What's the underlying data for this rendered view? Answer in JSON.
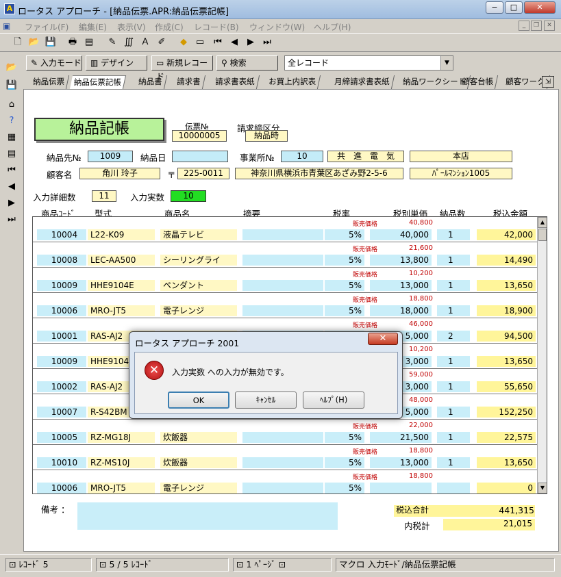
{
  "window": {
    "title": "ロータス アプローチ - [納品伝票.APR:納品伝票記帳]",
    "min": "−",
    "max": "□",
    "close": "✕"
  },
  "menu": [
    "ファイル(F)",
    "編集(E)",
    "表示(V)",
    "作成(C)",
    "レコード(B)",
    "ウィンドウ(W)",
    "ヘルプ(H)"
  ],
  "actionbar": {
    "mode_label": "入力モード",
    "design_label": "デザイン",
    "new_record_label": "新規レコード",
    "find_label": "検索",
    "filter_value": "全レコード"
  },
  "tabs": [
    "納品伝票",
    "納品伝票記帳",
    "納品書",
    "請求書",
    "請求書表紙",
    "お買上内訳表",
    "月締請求書表紙",
    "納品ワークシート",
    "顧客台帳",
    "顧客ワーク"
  ],
  "form": {
    "title": "納品記帳",
    "slip_no_label": "伝票№",
    "slip_no": "10000005",
    "billing_label": "請求締区分",
    "billing": "納品時",
    "dest_no_label": "納品先№",
    "dest_no": "1009",
    "delivery_date_label": "納品日",
    "delivery_date": "",
    "office_no_label": "事業所№",
    "office_no": "10",
    "company": "共　進　電　気",
    "branch": "本店",
    "customer_label": "顧客名",
    "customer": "角川 玲子",
    "zip_mark": "〒",
    "zip": "225-0011",
    "address": "神奈川県横浜市青葉区あざみ野2-5-6",
    "building": "ﾊﾟｰﾙﾏﾝｼｮﾝ1005",
    "detail_count_label": "入力詳細数",
    "detail_count": "11",
    "actual_count_label": "入力実数",
    "actual_count": "10"
  },
  "columns": {
    "code": "商品ｺｰﾄﾞ",
    "model": "型式",
    "name": "商品名",
    "note": "摘要",
    "tax": "税率",
    "unit": "税別単価",
    "qty": "納品数",
    "amount": "税込金額"
  },
  "price_tag": "販売価格",
  "rows": [
    {
      "code": "10004",
      "model": "L22-K09",
      "name": "液晶テレビ",
      "tax": "5%",
      "sale": "40,800",
      "unit": "40,000",
      "qty": "1",
      "amount": "42,000"
    },
    {
      "code": "10008",
      "model": "LEC-AA500",
      "name": "シーリングライ",
      "tax": "5%",
      "sale": "21,600",
      "unit": "13,800",
      "qty": "1",
      "amount": "14,490"
    },
    {
      "code": "10009",
      "model": "HHE9104E",
      "name": "ペンダント",
      "tax": "5%",
      "sale": "10,200",
      "unit": "13,000",
      "qty": "1",
      "amount": "13,650"
    },
    {
      "code": "10006",
      "model": "MRO-JT5",
      "name": "電子レンジ",
      "tax": "5%",
      "sale": "18,800",
      "unit": "18,000",
      "qty": "1",
      "amount": "18,900"
    },
    {
      "code": "10001",
      "model": "RAS-AJ2",
      "name": "",
      "tax": "",
      "sale": "46,000",
      "unit": "5,000",
      "qty": "2",
      "amount": "94,500"
    },
    {
      "code": "10009",
      "model": "HHE9104",
      "name": "",
      "tax": "",
      "sale": "10,200",
      "unit": "3,000",
      "qty": "1",
      "amount": "13,650"
    },
    {
      "code": "10002",
      "model": "RAS-AJ2",
      "name": "",
      "tax": "",
      "sale": "59,000",
      "unit": "3,000",
      "qty": "1",
      "amount": "55,650"
    },
    {
      "code": "10007",
      "model": "R-S42BM",
      "name": "",
      "tax": "",
      "sale": "48,000",
      "unit": "5,000",
      "qty": "1",
      "amount": "152,250"
    },
    {
      "code": "10005",
      "model": "RZ-MG18J",
      "name": "炊飯器",
      "tax": "5%",
      "sale": "22,000",
      "unit": "21,500",
      "qty": "1",
      "amount": "22,575"
    },
    {
      "code": "10010",
      "model": "RZ-MS10J",
      "name": "炊飯器",
      "tax": "5%",
      "sale": "18,800",
      "unit": "13,000",
      "qty": "1",
      "amount": "13,650"
    },
    {
      "code": "10006",
      "model": "MRO-JT5",
      "name": "電子レンジ",
      "tax": "5%",
      "sale": "18,800",
      "unit": "",
      "qty": "",
      "amount": "0"
    }
  ],
  "footer": {
    "memo_label": "備考 ：",
    "total_label": "税込合計",
    "total": "441,315",
    "tax_label": "内税計",
    "tax": "21,015"
  },
  "status": {
    "record": "ﾚｺｰﾄﾞ 5",
    "count": "5 / 5 ﾚｺｰﾄﾞ",
    "page": "1 ﾍﾟｰｼﾞ",
    "macro": "マクロ 入力ﾓｰﾄﾞ/納品伝票記帳"
  },
  "dialog": {
    "title": "ロータス アプローチ 2001",
    "message": "入力実数 への入力が無効です。",
    "ok": "OK",
    "cancel": "ｷｬﾝｾﾙ",
    "help": "ﾍﾙﾌﾟ(H)",
    "close": "✕"
  }
}
